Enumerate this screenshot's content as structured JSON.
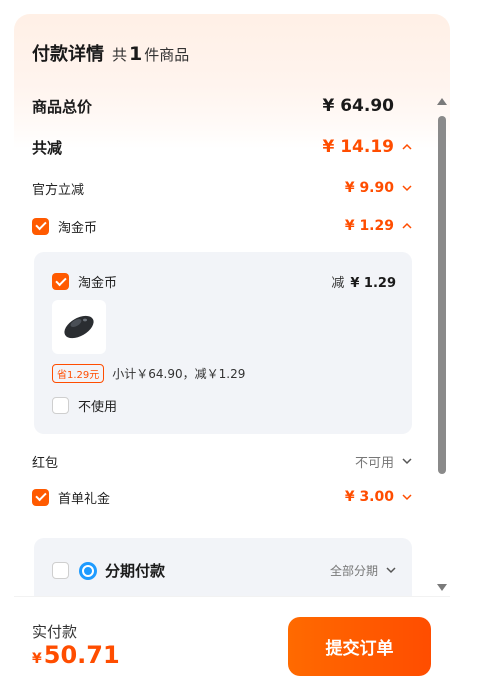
{
  "header": {
    "title": "付款详情",
    "count_prefix": "共",
    "count": "1",
    "count_suffix": "件商品"
  },
  "rows": {
    "total": {
      "label": "商品总价",
      "amount": "¥ 64.90"
    },
    "discount": {
      "label": "共减",
      "amount": "¥ 14.19"
    },
    "official": {
      "label": "官方立减",
      "amount": "¥ 9.90"
    },
    "coins": {
      "label": "淘金币",
      "amount": "¥ 1.29"
    },
    "redpacket": {
      "label": "红包",
      "status": "不可用"
    },
    "firstorder": {
      "label": "首单礼金",
      "amount": "¥ 3.00"
    }
  },
  "coin_detail": {
    "label": "淘金币",
    "reduce_prefix": "减",
    "reduce_amount": "¥ 1.29",
    "save_badge": "省1.29元",
    "subtotal": "小计￥64.90，减￥1.29",
    "nouse_label": "不使用",
    "product_icon": "mouse-image"
  },
  "installment": {
    "label": "分期付款",
    "option": "全部分期"
  },
  "footer": {
    "pay_label": "实付款",
    "currency": "¥",
    "pay_amount": "50.71",
    "submit_label": "提交订单"
  },
  "colors": {
    "accent": "#ff4d00",
    "panel": "#f2f4f8",
    "installment_icon": "#1e9bff"
  }
}
